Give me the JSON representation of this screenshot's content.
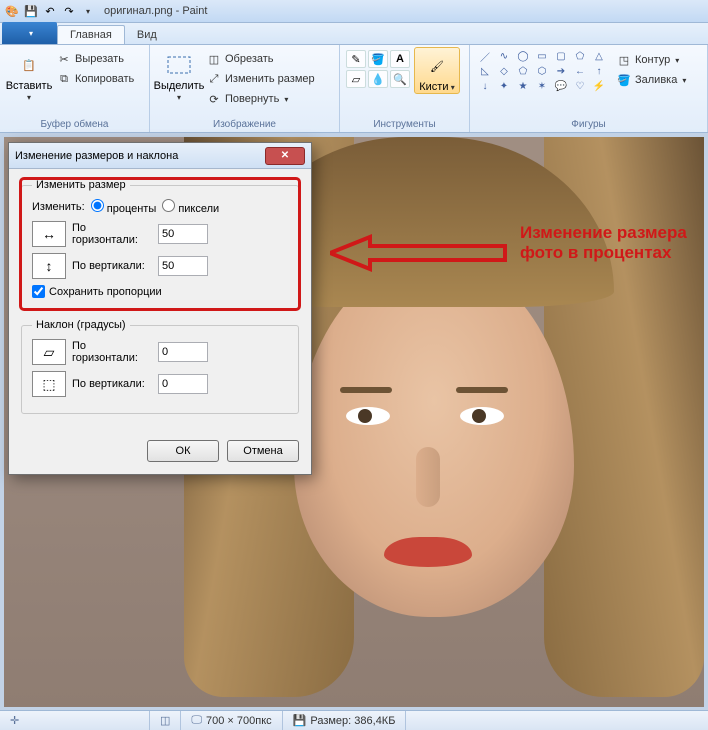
{
  "app": {
    "title": "оригинал.png - Paint"
  },
  "tabs": {
    "file": "",
    "main": "Главная",
    "view": "Вид"
  },
  "ribbon": {
    "clipboard": {
      "label": "Буфер обмена",
      "paste": "Вставить",
      "cut": "Вырезать",
      "copy": "Копировать"
    },
    "image": {
      "label": "Изображение",
      "select": "Выделить",
      "crop": "Обрезать",
      "resize": "Изменить размер",
      "rotate": "Повернуть"
    },
    "tools": {
      "label": "Инструменты",
      "brushes": "Кисти"
    },
    "shapes": {
      "label": "Фигуры",
      "outline": "Контур",
      "fill": "Заливка"
    }
  },
  "dialog": {
    "title": "Изменение размеров и наклона",
    "resize_legend": "Изменить размер",
    "change_lbl": "Изменить:",
    "opt_percent": "проценты",
    "opt_pixels": "пиксели",
    "horiz": "По горизонтали:",
    "vert": "По вертикали:",
    "h_val": "50",
    "v_val": "50",
    "keep_ratio": "Сохранить пропорции",
    "skew_legend": "Наклон (градусы)",
    "skew_h_val": "0",
    "skew_v_val": "0",
    "ok": "ОК",
    "cancel": "Отмена"
  },
  "annotation": {
    "text": "Изменение размера фото в процентах"
  },
  "status": {
    "dims": "700 × 700пкс",
    "size": "Размер: 386,4КБ"
  }
}
